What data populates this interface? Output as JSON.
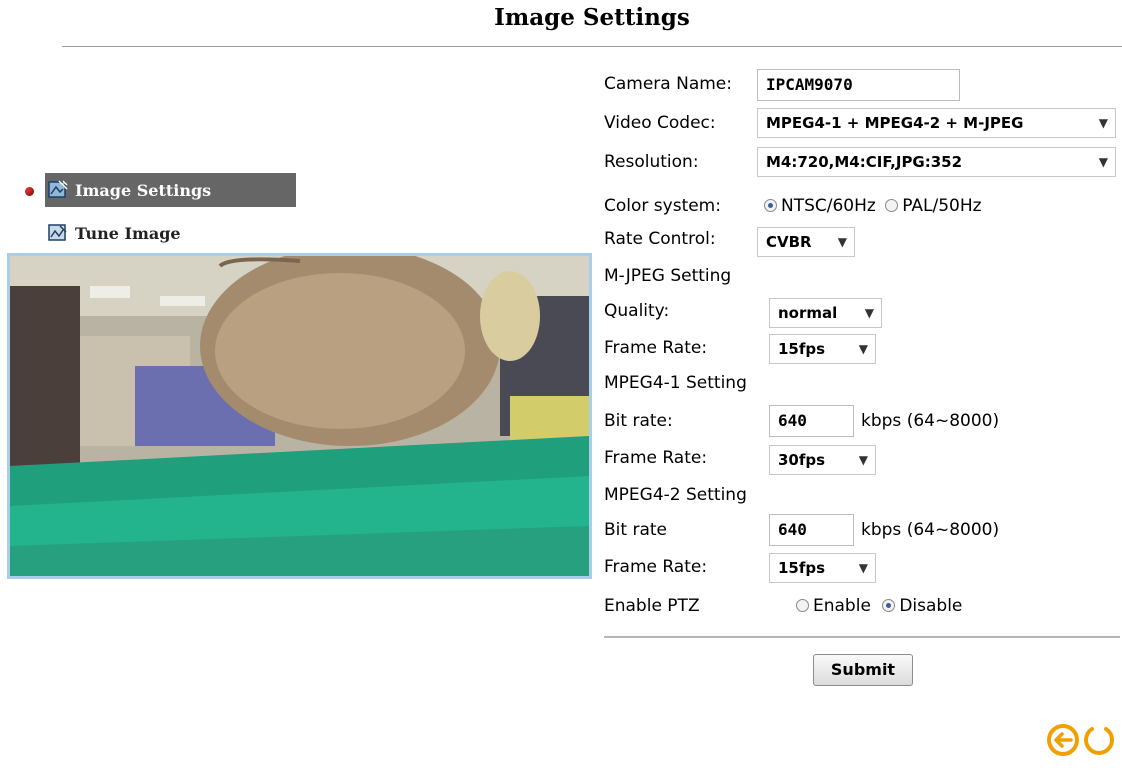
{
  "page": {
    "title": "Image Settings"
  },
  "nav": {
    "items": [
      {
        "label": "Image Settings",
        "active": true,
        "icon": "image-settings-icon"
      },
      {
        "label": "Tune Image",
        "active": false,
        "icon": "tune-image-icon"
      }
    ]
  },
  "form": {
    "camera_name": {
      "label": "Camera Name:",
      "value": "IPCAM9070"
    },
    "video_codec": {
      "label": "Video Codec:",
      "value": "MPEG4-1 + MPEG4-2 + M-JPEG"
    },
    "resolution": {
      "label": "Resolution:",
      "value": "M4:720,M4:CIF,JPG:352"
    },
    "color_system": {
      "label": "Color system:",
      "options": [
        "NTSC/60Hz",
        "PAL/50Hz"
      ],
      "selected": "NTSC/60Hz"
    },
    "rate_control": {
      "label": "Rate Control:",
      "value": "CVBR"
    },
    "mjpeg": {
      "title": "M-JPEG Setting",
      "quality_label": "Quality:",
      "quality_value": "normal",
      "frame_rate_label": "Frame Rate:",
      "frame_rate_value": "15fps"
    },
    "mpeg4_1": {
      "title": "MPEG4-1 Setting",
      "bit_rate_label": "Bit rate:",
      "bit_rate_value": "640",
      "bit_rate_unit": "kbps (64~8000)",
      "frame_rate_label": "Frame Rate:",
      "frame_rate_value": "30fps"
    },
    "mpeg4_2": {
      "title": "MPEG4-2 Setting",
      "bit_rate_label": "Bit rate",
      "bit_rate_value": "640",
      "bit_rate_unit": "kbps (64~8000)",
      "frame_rate_label": "Frame Rate:",
      "frame_rate_value": "15fps"
    },
    "ptz": {
      "label": "Enable PTZ",
      "options": [
        "Enable",
        "Disable"
      ],
      "selected": "Disable"
    },
    "submit_label": "Submit"
  },
  "footer": {
    "icons": [
      "back-arrow-icon",
      "refresh-icon"
    ],
    "accent": "#f0a000"
  }
}
